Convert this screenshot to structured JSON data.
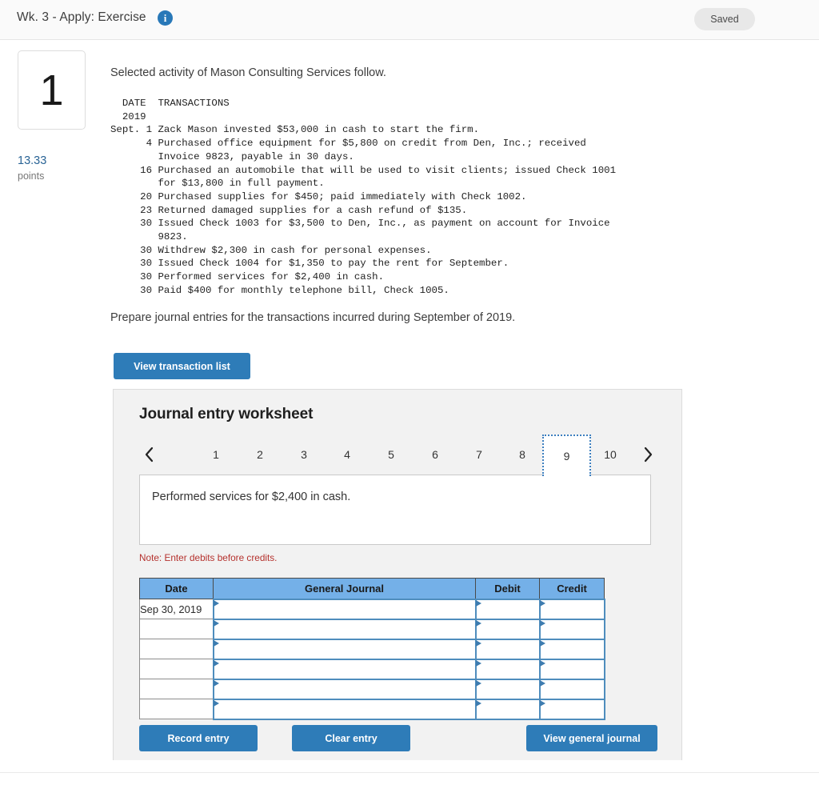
{
  "header": {
    "title": "Wk. 3 - Apply: Exercise",
    "info_icon": "info-icon",
    "save_status": "Saved"
  },
  "question": {
    "number": "1",
    "points_value": "13.33",
    "points_label": "points",
    "intro": "Selected activity of Mason Consulting Services follow.",
    "transactions_text": "  DATE  TRANSACTIONS\n  2019\nSept. 1 Zack Mason invested $53,000 in cash to start the firm.\n      4 Purchased office equipment for $5,800 on credit from Den, Inc.; received\n        Invoice 9823, payable in 30 days.\n     16 Purchased an automobile that will be used to visit clients; issued Check 1001\n        for $13,800 in full payment.\n     20 Purchased supplies for $450; paid immediately with Check 1002.\n     23 Returned damaged supplies for a cash refund of $135.\n     30 Issued Check 1003 for $3,500 to Den, Inc., as payment on account for Invoice\n        9823.\n     30 Withdrew $2,300 in cash for personal expenses.\n     30 Issued Check 1004 for $1,350 to pay the rent for September.\n     30 Performed services for $2,400 in cash.\n     30 Paid $400 for monthly telephone bill, Check 1005.",
    "instruction": "Prepare journal entries for the transactions incurred during September of 2019.",
    "view_transaction_list_label": "View transaction list"
  },
  "worksheet": {
    "title": "Journal entry worksheet",
    "pager": {
      "prev_label": "previous",
      "next_label": "next",
      "pages": [
        "1",
        "2",
        "3",
        "4",
        "5",
        "6",
        "7",
        "8",
        "9",
        "10"
      ],
      "active_page": "9"
    },
    "prompt": "Performed services for $2,400 in cash.",
    "note": "Note: Enter debits before credits.",
    "table": {
      "columns": [
        "Date",
        "General Journal",
        "Debit",
        "Credit"
      ],
      "rows": [
        {
          "date": "Sep 30, 2019",
          "general_journal": "",
          "debit": "",
          "credit": ""
        },
        {
          "date": "",
          "general_journal": "",
          "debit": "",
          "credit": ""
        },
        {
          "date": "",
          "general_journal": "",
          "debit": "",
          "credit": ""
        },
        {
          "date": "",
          "general_journal": "",
          "debit": "",
          "credit": ""
        },
        {
          "date": "",
          "general_journal": "",
          "debit": "",
          "credit": ""
        },
        {
          "date": "",
          "general_journal": "",
          "debit": "",
          "credit": ""
        }
      ]
    },
    "buttons": {
      "record_entry": "Record entry",
      "clear_entry": "Clear entry",
      "view_general_journal": "View general journal"
    }
  },
  "colors": {
    "primary_blue": "#2e7cb8",
    "table_header_blue": "#74b0e8",
    "note_red": "#b5322e",
    "points_blue": "#2a6496",
    "panel_gray": "#f2f2f2"
  }
}
